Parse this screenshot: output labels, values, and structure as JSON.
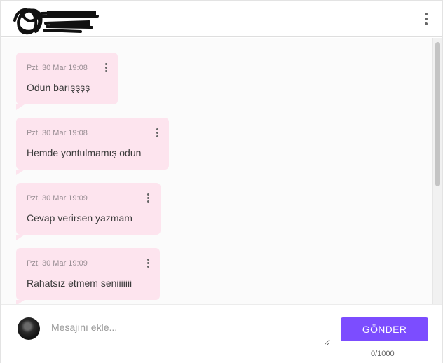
{
  "header": {
    "menu_icon": "more-vertical-icon"
  },
  "messages": [
    {
      "time": "Pzt, 30 Mar 19:08",
      "text": "Odun barışşşş"
    },
    {
      "time": "Pzt, 30 Mar 19:08",
      "text": "Hemde yontulmamış odun"
    },
    {
      "time": "Pzt, 30 Mar 19:09",
      "text": "Cevap verirsen yazmam"
    },
    {
      "time": "Pzt, 30 Mar 19:09",
      "text": "Rahatsız etmem seniiiiiii"
    }
  ],
  "composer": {
    "placeholder": "Mesajını ekle...",
    "value": "",
    "send_label": "GÖNDER",
    "char_count": "0/1000"
  },
  "colors": {
    "bubble": "#fde4ee",
    "accent": "#7c4dff"
  }
}
